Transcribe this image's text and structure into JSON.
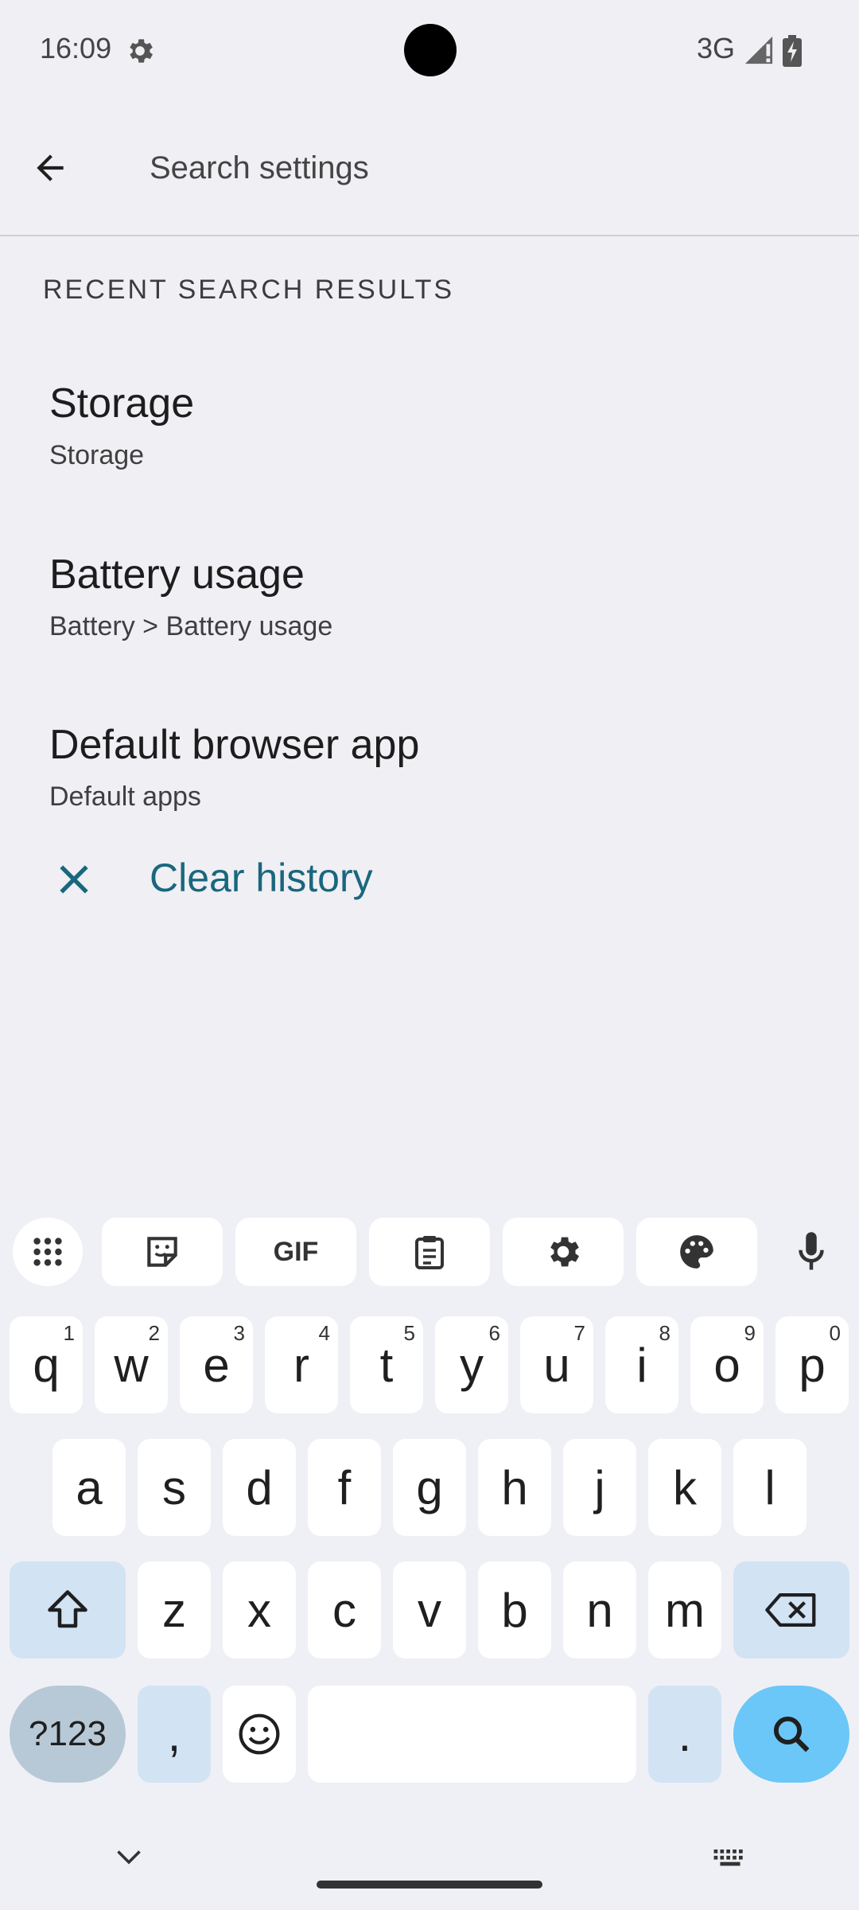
{
  "status_bar": {
    "time": "16:09",
    "network": "3G"
  },
  "search": {
    "placeholder": "Search settings",
    "value": ""
  },
  "recent": {
    "section_title": "RECENT SEARCH RESULTS",
    "items": [
      {
        "title": "Storage",
        "subtitle": "Storage"
      },
      {
        "title": "Battery usage",
        "subtitle": "Battery > Battery usage"
      },
      {
        "title": "Default browser app",
        "subtitle": "Default apps"
      }
    ],
    "clear_label": "Clear history"
  },
  "keyboard": {
    "toolbar": {
      "gif_label": "GIF"
    },
    "rows": [
      [
        {
          "key": "q",
          "hint": "1"
        },
        {
          "key": "w",
          "hint": "2"
        },
        {
          "key": "e",
          "hint": "3"
        },
        {
          "key": "r",
          "hint": "4"
        },
        {
          "key": "t",
          "hint": "5"
        },
        {
          "key": "y",
          "hint": "6"
        },
        {
          "key": "u",
          "hint": "7"
        },
        {
          "key": "i",
          "hint": "8"
        },
        {
          "key": "o",
          "hint": "9"
        },
        {
          "key": "p",
          "hint": "0"
        }
      ],
      [
        {
          "key": "a"
        },
        {
          "key": "s"
        },
        {
          "key": "d"
        },
        {
          "key": "f"
        },
        {
          "key": "g"
        },
        {
          "key": "h"
        },
        {
          "key": "j"
        },
        {
          "key": "k"
        },
        {
          "key": "l"
        }
      ],
      [
        {
          "key": "z"
        },
        {
          "key": "x"
        },
        {
          "key": "c"
        },
        {
          "key": "v"
        },
        {
          "key": "b"
        },
        {
          "key": "n"
        },
        {
          "key": "m"
        }
      ]
    ],
    "symbols_label": "?123",
    "comma_label": ",",
    "period_label": "."
  }
}
